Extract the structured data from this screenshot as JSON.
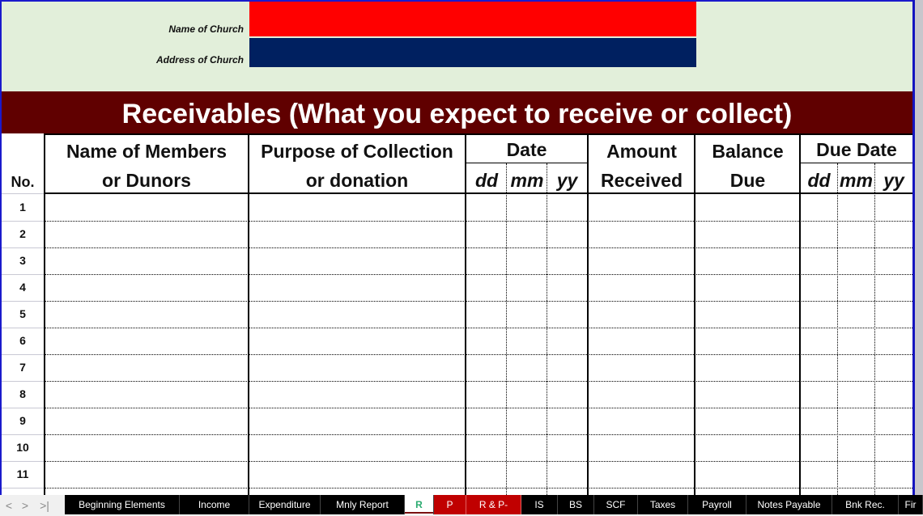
{
  "header": {
    "name_label": "Name of Church",
    "address_label": "Address of Church",
    "name_value": "",
    "address_value": "",
    "name_field_color": "#ff0000",
    "address_field_color": "#002060"
  },
  "title": "Receivables (What you expect to receive or collect)",
  "table": {
    "columns": {
      "no": "No.",
      "name_line1": "Name of Members",
      "name_line2": "or Dunors",
      "purpose_line1": "Purpose of Collection",
      "purpose_line2": "or donation",
      "date": "Date",
      "date_dd": "dd",
      "date_mm": "mm",
      "date_yy": "yy",
      "amount_line1": "Amount",
      "amount_line2": "Received",
      "balance_line1": "Balance",
      "balance_line2": "Due",
      "due_date": "Due Date",
      "due_dd": "dd",
      "due_mm": "mm",
      "due_yy": "yy"
    },
    "rows": [
      "1",
      "2",
      "3",
      "4",
      "5",
      "6",
      "7",
      "8",
      "9",
      "10",
      "11"
    ]
  },
  "sheet_tabs": {
    "nav": [
      "<",
      ">",
      ">|"
    ],
    "tabs": [
      {
        "label": "Beginning Elements",
        "style": "black"
      },
      {
        "label": "Income",
        "style": "black"
      },
      {
        "label": "Expenditure",
        "style": "black"
      },
      {
        "label": "Mnly Report",
        "style": "black"
      },
      {
        "label": "R",
        "style": "active"
      },
      {
        "label": "P",
        "style": "red"
      },
      {
        "label": "R & P-",
        "style": "red"
      },
      {
        "label": "IS",
        "style": "black"
      },
      {
        "label": "BS",
        "style": "black"
      },
      {
        "label": "SCF",
        "style": "black"
      },
      {
        "label": "Taxes",
        "style": "black"
      },
      {
        "label": "Payroll",
        "style": "black"
      },
      {
        "label": "Notes Payable",
        "style": "black"
      },
      {
        "label": "Bnk Rec.",
        "style": "black"
      },
      {
        "label": "Fir",
        "style": "black"
      }
    ],
    "active_tab": "R"
  },
  "colors": {
    "info_band": "#e2efda",
    "title_bar": "#600000",
    "tab_red": "#c00000",
    "active_tab_text": "#2bab70"
  }
}
